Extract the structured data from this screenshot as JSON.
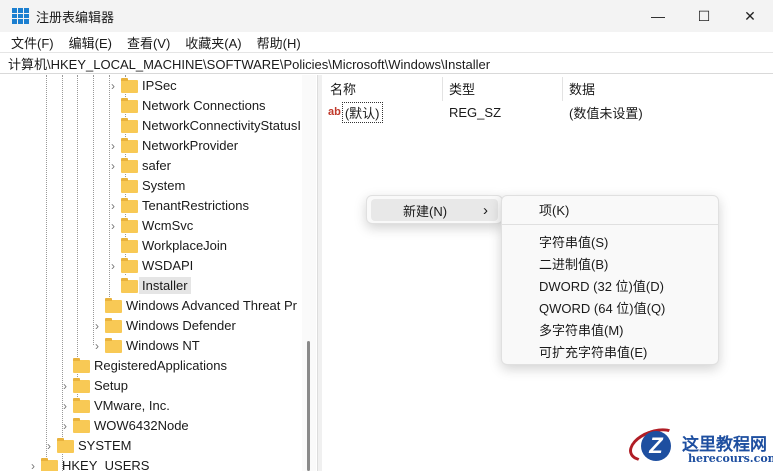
{
  "window": {
    "title": "注册表编辑器",
    "minimize": "—",
    "maximize": "☐",
    "close": "✕"
  },
  "menu": [
    "文件(F)",
    "编辑(E)",
    "查看(V)",
    "收藏夹(A)",
    "帮助(H)"
  ],
  "address": "计算机\\HKEY_LOCAL_MACHINE\\SOFTWARE\\Policies\\Microsoft\\Windows\\Installer",
  "tree": [
    {
      "label": "IPSec",
      "level": 5,
      "expandable": true
    },
    {
      "label": "Network Connections",
      "level": 5,
      "expandable": false
    },
    {
      "label": "NetworkConnectivityStatusI",
      "level": 5,
      "expandable": false
    },
    {
      "label": "NetworkProvider",
      "level": 5,
      "expandable": true
    },
    {
      "label": "safer",
      "level": 5,
      "expandable": true
    },
    {
      "label": "System",
      "level": 5,
      "expandable": false
    },
    {
      "label": "TenantRestrictions",
      "level": 5,
      "expandable": true
    },
    {
      "label": "WcmSvc",
      "level": 5,
      "expandable": true
    },
    {
      "label": "WorkplaceJoin",
      "level": 5,
      "expandable": false
    },
    {
      "label": "WSDAPI",
      "level": 5,
      "expandable": true
    },
    {
      "label": "Installer",
      "level": 5,
      "expandable": false,
      "selected": true
    },
    {
      "label": "Windows Advanced Threat Pr",
      "level": 4,
      "expandable": false
    },
    {
      "label": "Windows Defender",
      "level": 4,
      "expandable": true
    },
    {
      "label": "Windows NT",
      "level": 4,
      "expandable": true
    },
    {
      "label": "RegisteredApplications",
      "level": 2,
      "expandable": false
    },
    {
      "label": "Setup",
      "level": 2,
      "expandable": true
    },
    {
      "label": "VMware, Inc.",
      "level": 2,
      "expandable": true
    },
    {
      "label": "WOW6432Node",
      "level": 2,
      "expandable": true
    },
    {
      "label": "SYSTEM",
      "level": 1,
      "expandable": true
    },
    {
      "label": "HKEY_USERS",
      "level": 0,
      "expandable": true
    }
  ],
  "list": {
    "columns": [
      "名称",
      "类型",
      "数据"
    ],
    "rows": [
      {
        "icon": "ab",
        "name": "(默认)",
        "type": "REG_SZ",
        "data": "(数值未设置)"
      }
    ]
  },
  "context_menu": {
    "new": "新建(N)",
    "arrow": "›"
  },
  "submenu": {
    "key": "项(K)",
    "items": [
      "字符串值(S)",
      "二进制值(B)",
      "DWORD (32 位)值(D)",
      "QWORD (64 位)值(Q)",
      "多字符串值(M)",
      "可扩充字符串值(E)"
    ]
  },
  "watermark": {
    "cn": "这里教程网",
    "en": "herecours.com",
    "logo": "Z"
  }
}
